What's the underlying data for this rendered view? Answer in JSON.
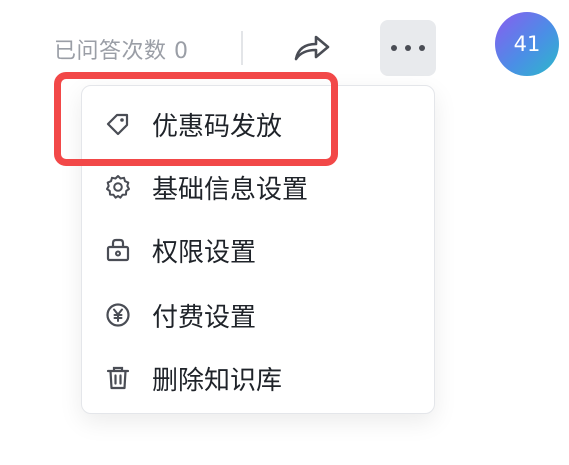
{
  "header": {
    "question_count_text": "已问答次数 0",
    "share_icon": "share-icon",
    "more_icon": "more-icon",
    "avatar_text": "41",
    "avatar_gradient": [
      "#8a5cf0",
      "#4b8ee6",
      "#2bb9c9"
    ]
  },
  "menu": {
    "items": [
      {
        "label": "优惠码发放",
        "icon": "tag-icon"
      },
      {
        "label": "基础信息设置",
        "icon": "gear-icon"
      },
      {
        "label": "权限设置",
        "icon": "lock-icon"
      },
      {
        "label": "付费设置",
        "icon": "yuan-icon"
      },
      {
        "label": "删除知识库",
        "icon": "trash-icon"
      }
    ]
  },
  "colors": {
    "highlight": "#f24848",
    "text": "#1f2329",
    "muted_text": "#9a9ea6",
    "icon": "#4a4d55"
  }
}
